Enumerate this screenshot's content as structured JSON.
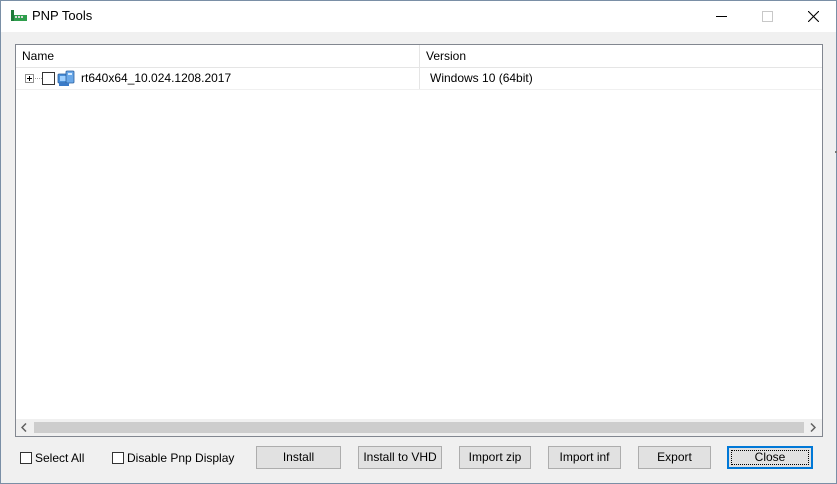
{
  "window": {
    "title": "PNP Tools",
    "icon": "green-device-icon"
  },
  "window_controls": {
    "minimize_icon": "minimize-icon",
    "maximize_icon": "maximize-icon",
    "close_icon": "close-icon"
  },
  "list": {
    "columns": [
      "Name",
      "Version"
    ],
    "rows": [
      {
        "name": "rt640x64_10.024.1208.2017",
        "version": "Windows 10 (64bit)",
        "checked": false,
        "expanded": false,
        "icon": "network-adapter-icon"
      }
    ]
  },
  "options": {
    "select_all_label": "Select All",
    "select_all_checked": false,
    "disable_pnp_label": "Disable Pnp Display",
    "disable_pnp_checked": false
  },
  "buttons": {
    "install": "Install",
    "install_vhd": "Install to VHD",
    "import_zip": "Import zip",
    "import_inf": "Import inf",
    "export": "Export",
    "close": "Close"
  },
  "colors": {
    "focus_border": "#0078d7",
    "button_face": "#e1e1e1",
    "window_bg": "#f0f0f0"
  }
}
